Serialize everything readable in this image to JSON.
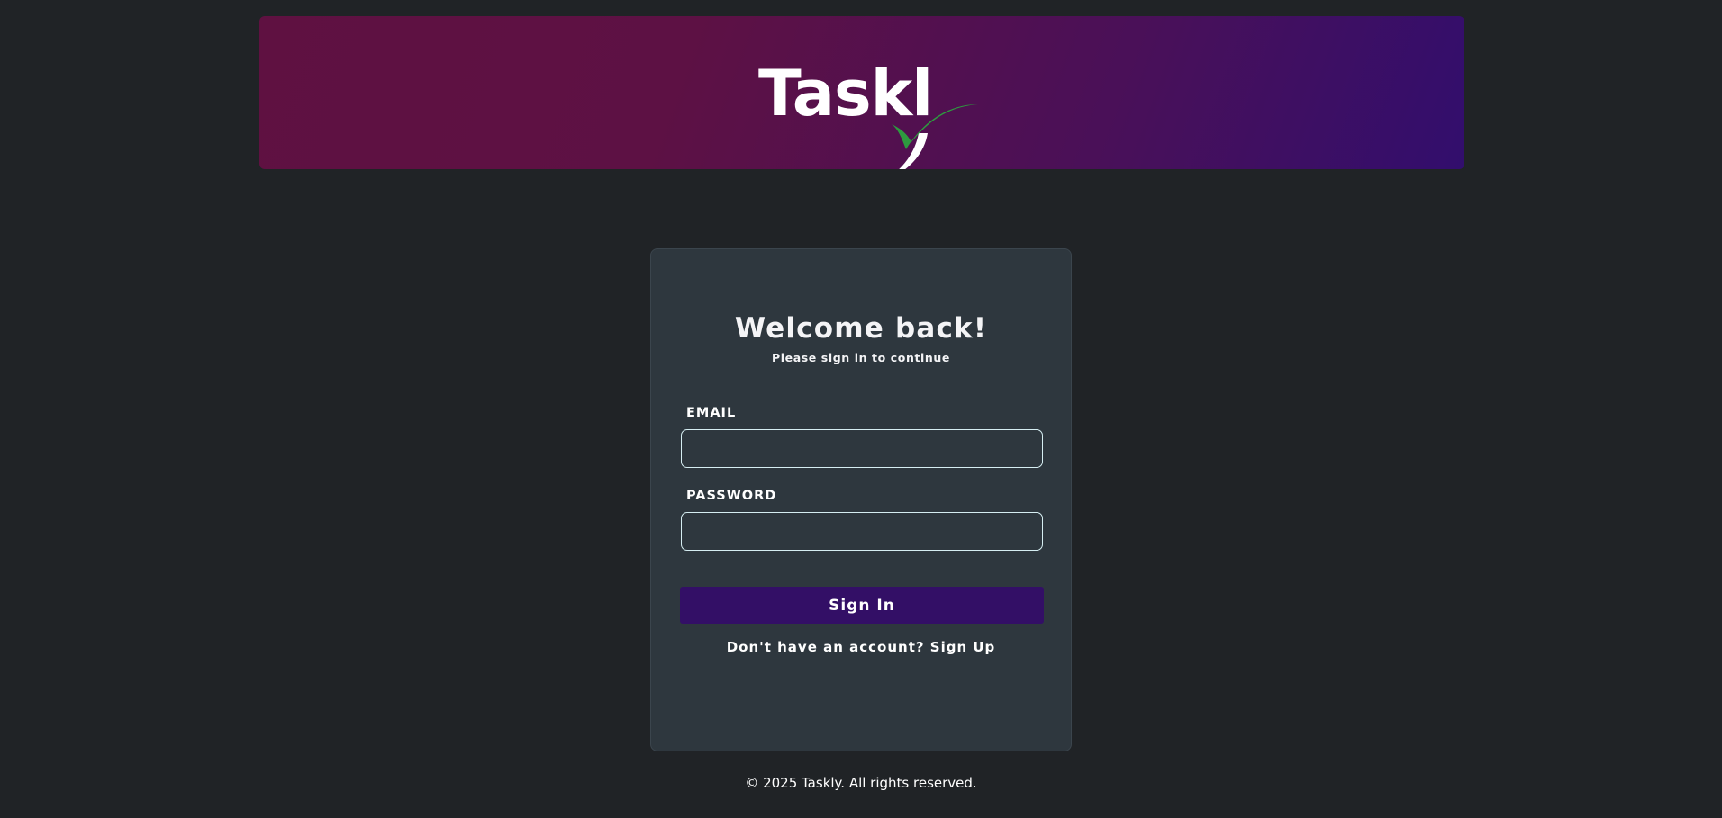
{
  "header": {
    "logo_text": "Taskl",
    "logo_icon": "checkmark-swoosh-icon",
    "gradient_colors": [
      "#5f1141",
      "#320e6d"
    ]
  },
  "login": {
    "title": "Welcome back!",
    "subtitle": "Please sign in to continue",
    "email_label": "EMAIL",
    "email_value": "",
    "password_label": "PASSWORD",
    "password_value": "",
    "signin_label": "Sign In",
    "signup_text": "Don't have an account? Sign Up"
  },
  "footer": {
    "copyright": "© 2025 Taskly. All rights reserved."
  },
  "colors": {
    "background": "#202326",
    "card": "#2e373e",
    "button": "#330f66",
    "input_border": "#d6eef2",
    "logo_check": "#2e9a3f"
  }
}
